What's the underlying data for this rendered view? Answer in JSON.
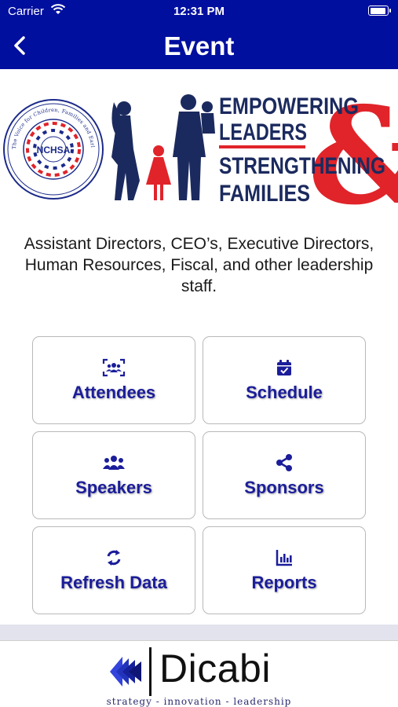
{
  "status_bar": {
    "carrier": "Carrier",
    "time": "12:31 PM",
    "wifi_icon": "wifi-icon",
    "battery_icon": "battery-icon"
  },
  "nav": {
    "title": "Event",
    "back_icon": "chevron-left-icon"
  },
  "banner": {
    "seal_text": "NCHSA",
    "seal_ring_text": "The Voice for Children, Families and Early Childhood Professionals",
    "headline_line1": "EMPOWERING",
    "headline_line2": "LEADERS",
    "headline_line3": "STRENGTHENING",
    "headline_line4": "FAMILIES",
    "ampersand": "&"
  },
  "description": "Assistant Directors, CEO’s, Executive Directors, Human Resources, Fiscal, and other leadership staff.",
  "tiles": [
    {
      "label": "Attendees",
      "icon": "attendees-icon"
    },
    {
      "label": "Schedule",
      "icon": "calendar-icon"
    },
    {
      "label": "Speakers",
      "icon": "people-group-icon"
    },
    {
      "label": "Sponsors",
      "icon": "share-icon"
    },
    {
      "label": "Refresh Data",
      "icon": "refresh-icon"
    },
    {
      "label": "Reports",
      "icon": "bar-chart-icon"
    }
  ],
  "footer": {
    "brand": "Dicabi",
    "tagline": "strategy - innovation - leadership"
  },
  "colors": {
    "header_blue": "#000f9e",
    "tile_text": "#1b1d9a",
    "banner_red": "#e0242a",
    "banner_navy": "#1b2a5e"
  }
}
